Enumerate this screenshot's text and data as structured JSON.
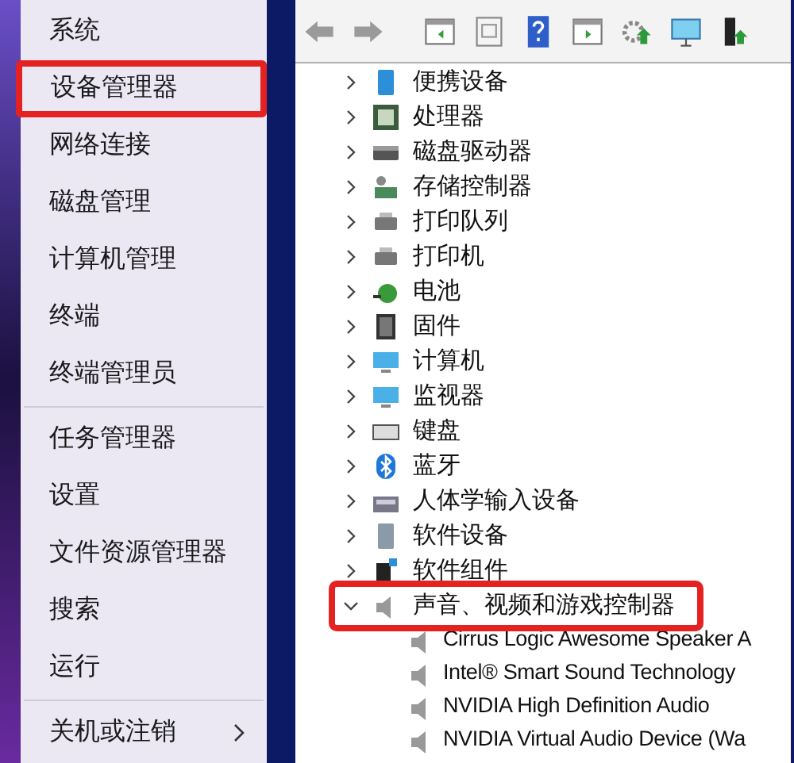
{
  "context_menu": {
    "groups": [
      [
        {
          "label": "系统",
          "highlighted": false,
          "submenu": false
        },
        {
          "label": "设备管理器",
          "highlighted": true,
          "submenu": false
        },
        {
          "label": "网络连接",
          "highlighted": false,
          "submenu": false
        },
        {
          "label": "磁盘管理",
          "highlighted": false,
          "submenu": false
        },
        {
          "label": "计算机管理",
          "highlighted": false,
          "submenu": false
        },
        {
          "label": "终端",
          "highlighted": false,
          "submenu": false
        },
        {
          "label": "终端管理员",
          "highlighted": false,
          "submenu": false
        }
      ],
      [
        {
          "label": "任务管理器",
          "highlighted": false,
          "submenu": false
        },
        {
          "label": "设置",
          "highlighted": false,
          "submenu": false
        },
        {
          "label": "文件资源管理器",
          "highlighted": false,
          "submenu": false
        },
        {
          "label": "搜索",
          "highlighted": false,
          "submenu": false
        },
        {
          "label": "运行",
          "highlighted": false,
          "submenu": false
        }
      ],
      [
        {
          "label": "关机或注销",
          "highlighted": false,
          "submenu": true
        }
      ]
    ]
  },
  "device_manager": {
    "tree": [
      {
        "label": "便携设备",
        "expanded": false,
        "highlighted": false
      },
      {
        "label": "处理器",
        "expanded": false,
        "highlighted": false
      },
      {
        "label": "磁盘驱动器",
        "expanded": false,
        "highlighted": false
      },
      {
        "label": "存储控制器",
        "expanded": false,
        "highlighted": false
      },
      {
        "label": "打印队列",
        "expanded": false,
        "highlighted": false
      },
      {
        "label": "打印机",
        "expanded": false,
        "highlighted": false
      },
      {
        "label": "电池",
        "expanded": false,
        "highlighted": false
      },
      {
        "label": "固件",
        "expanded": false,
        "highlighted": false
      },
      {
        "label": "计算机",
        "expanded": false,
        "highlighted": false
      },
      {
        "label": "监视器",
        "expanded": false,
        "highlighted": false
      },
      {
        "label": "键盘",
        "expanded": false,
        "highlighted": false
      },
      {
        "label": "蓝牙",
        "expanded": false,
        "highlighted": false
      },
      {
        "label": "人体学输入设备",
        "expanded": false,
        "highlighted": false
      },
      {
        "label": "软件设备",
        "expanded": false,
        "highlighted": false
      },
      {
        "label": "软件组件",
        "expanded": false,
        "highlighted": false
      },
      {
        "label": "声音、视频和游戏控制器",
        "expanded": true,
        "highlighted": true,
        "children": [
          {
            "label": "Cirrus Logic Awesome Speaker A"
          },
          {
            "label": "Intel® Smart Sound Technology"
          },
          {
            "label": "NVIDIA High Definition Audio"
          },
          {
            "label": "NVIDIA Virtual Audio Device (Wa"
          }
        ]
      }
    ]
  }
}
